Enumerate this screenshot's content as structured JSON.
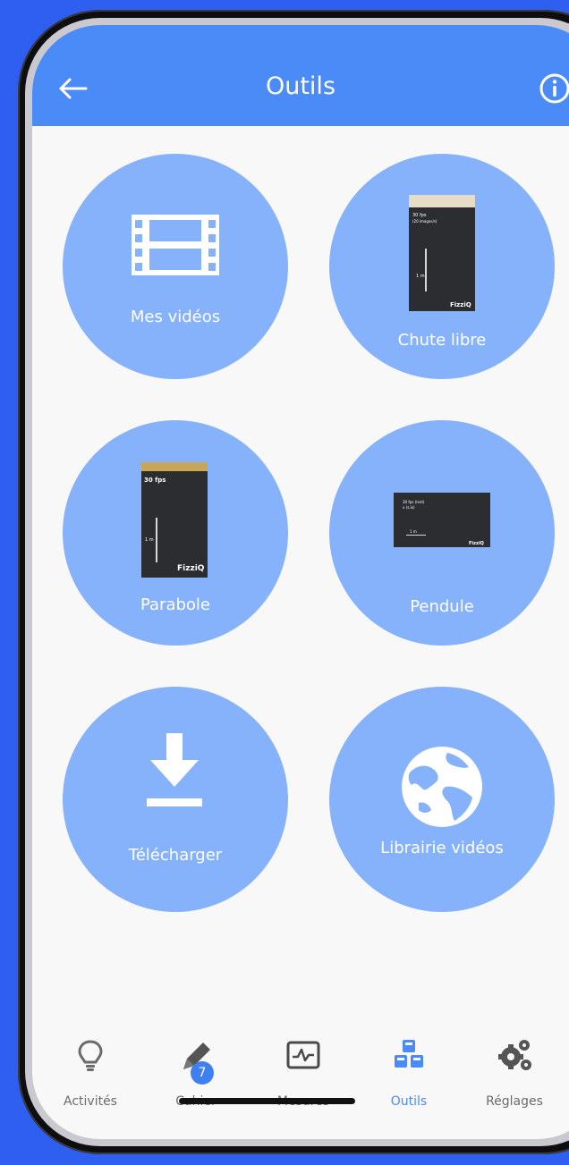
{
  "app_bar": {
    "title": "Outils",
    "back_icon": "arrow-left-icon",
    "info_icon": "info-icon"
  },
  "tiles": [
    {
      "id": "mes-videos",
      "label": "Mes vidéos",
      "icon": "film-icon"
    },
    {
      "id": "chute-libre",
      "label": "Chute libre",
      "thumbnail": {
        "fps": "30 fps",
        "sub": "(20 images/s)",
        "scale": "1 m",
        "brand": "FizziQ"
      }
    },
    {
      "id": "parabole",
      "label": "Parabole",
      "thumbnail": {
        "fps": "30 fps",
        "scale": "1 m",
        "brand": "FizziQ"
      }
    },
    {
      "id": "pendule",
      "label": "Pendule",
      "thumbnail": {
        "fps": "30 fps (lent)",
        "sub": "x (s.lx)",
        "scale": "1 m",
        "brand": "FizziQ"
      }
    },
    {
      "id": "telecharger",
      "label": "Télécharger",
      "icon": "download-icon"
    },
    {
      "id": "librairie-videos",
      "label": "Librairie vidéos",
      "icon": "globe-icon"
    }
  ],
  "bottom_nav": {
    "active": "Outils",
    "items": [
      {
        "label": "Activités",
        "icon": "lightbulb-icon"
      },
      {
        "label": "Cahier",
        "icon": "pencil-icon",
        "badge": "7"
      },
      {
        "label": "Mesures",
        "icon": "waveform-icon"
      },
      {
        "label": "Outils",
        "icon": "cubes-icon"
      },
      {
        "label": "Réglages",
        "icon": "gears-icon"
      }
    ]
  },
  "colors": {
    "accent": "#4a8bf7",
    "tile": "#86b2fb",
    "background": "#2f5ff0",
    "screen": "#f8f8f8",
    "nav_inactive": "#6b6b6b",
    "badge": "#3f7ff2"
  }
}
